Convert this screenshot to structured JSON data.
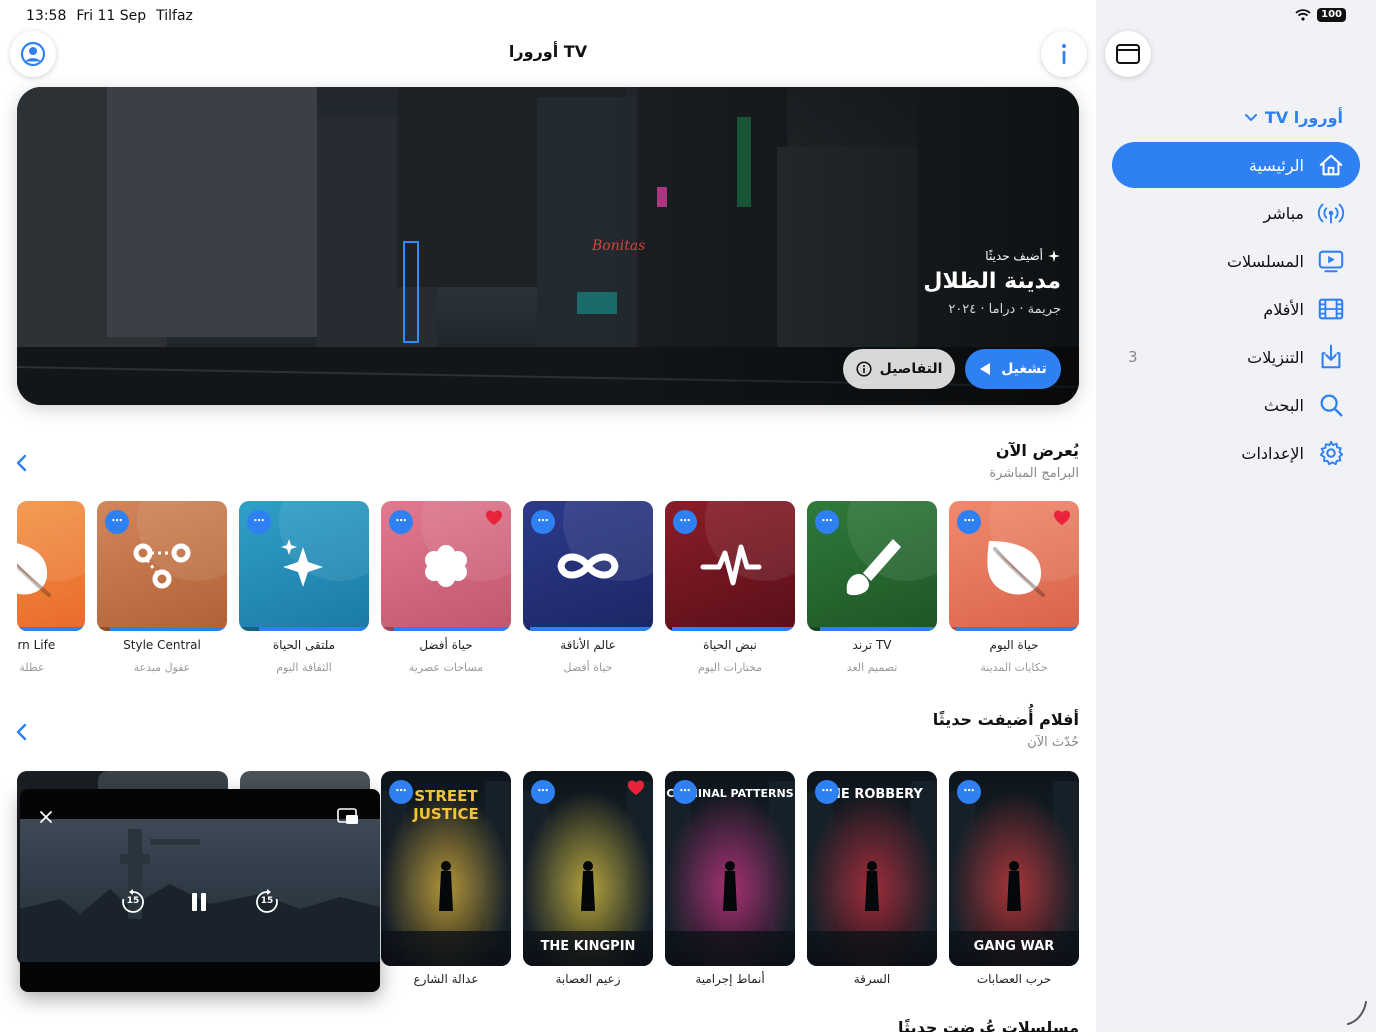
{
  "status_bar": {
    "time": "13:58",
    "date": "Fri 11 Sep",
    "carrier": "Tilfaz",
    "battery": "100"
  },
  "app": {
    "title": "أورورا TV"
  },
  "hero": {
    "badge": "أضيف حديثًا",
    "title": "مدينة الظلال",
    "meta": "جريمة · دراما · ٢٠٢٤",
    "play_label": "تشغيل",
    "details_label": "التفاصيل"
  },
  "now_showing": {
    "title": "يُعرض الآن",
    "subtitle": "البرامج المباشرة",
    "items": [
      {
        "name": "حياة اليوم",
        "sub": "حكايات المدينة",
        "c1": "#f08a6e",
        "c2": "#d9634a",
        "icon": "leaf-icon",
        "heart": true,
        "progress": 0.95
      },
      {
        "name": "ترند TV",
        "sub": "تصميم الغد",
        "c1": "#2f7a3a",
        "c2": "#1e5526",
        "icon": "brush-icon",
        "heart": false,
        "progress": 0.9
      },
      {
        "name": "نبض الحياة",
        "sub": "مختارات اليوم",
        "c1": "#8a1e2a",
        "c2": "#5a0f18",
        "icon": "pulse-icon",
        "heart": false,
        "progress": 0.95
      },
      {
        "name": "عالم الأناقة",
        "sub": "حياة أفضل",
        "c1": "#2d3a8a",
        "c2": "#1c2666",
        "icon": "infinity-icon",
        "heart": false,
        "progress": 0.95
      },
      {
        "name": "حياة أفضل",
        "sub": "مساحات عصرية",
        "c1": "#e07a90",
        "c2": "#c2566c",
        "icon": "flower-icon",
        "heart": true,
        "progress": 0.9
      },
      {
        "name": "ملتقى الحياة",
        "sub": "الثقافة اليوم",
        "c1": "#2fa0c8",
        "c2": "#1a7aa6",
        "icon": "sparkle-icon",
        "heart": false,
        "progress": 0.85
      },
      {
        "name": "Style Central",
        "sub": "عقول مبدعة",
        "c1": "#d2865a",
        "c2": "#b06236",
        "icon": "nodes-icon",
        "heart": false,
        "progress": 0.9
      },
      {
        "name": "Modern Life",
        "sub": "عطلة نهاية",
        "c1": "#f29a4a",
        "c2": "#ea6a2c",
        "icon": "leaf-icon",
        "heart": false,
        "progress": 0.8
      }
    ]
  },
  "recent_movies": {
    "title": "أفلام أُضيفت حديثًا",
    "subtitle": "حُدّث الآن",
    "items": [
      {
        "name": "حرب العصابات",
        "poster_text": "GANG WAR",
        "heart": false,
        "accent": "#e23a3a"
      },
      {
        "name": "السرقة",
        "poster_text": "THE ROBBERY",
        "heart": false,
        "accent": "#d62d3a"
      },
      {
        "name": "أنماط إجرامية",
        "poster_text": "CRIMINAL PATTERNS",
        "heart": false,
        "accent": "#e0348a"
      },
      {
        "name": "زعيم العصابة",
        "poster_text": "THE KINGPIN",
        "heart": true,
        "accent": "#f2d640"
      },
      {
        "name": "عدالة الشارع",
        "poster_text": "STREET JUSTICE",
        "heart": false,
        "accent": "#f2c23a"
      }
    ]
  },
  "next_section_title": "مسلسلات عُرضت حديثًا",
  "pip": {
    "skip_back": "15",
    "skip_forward": "15"
  },
  "sidebar": {
    "header": "أورورا TV",
    "items": [
      {
        "label": "الرئيسية",
        "icon": "home-icon",
        "active": true,
        "badge": ""
      },
      {
        "label": "مباشر",
        "icon": "broadcast-icon",
        "active": false,
        "badge": ""
      },
      {
        "label": "المسلسلات",
        "icon": "tv-play-icon",
        "active": false,
        "badge": ""
      },
      {
        "label": "الأفلام",
        "icon": "film-icon",
        "active": false,
        "badge": ""
      },
      {
        "label": "التنزيلات",
        "icon": "download-icon",
        "active": false,
        "badge": "3"
      },
      {
        "label": "البحث",
        "icon": "search-icon",
        "active": false,
        "badge": ""
      },
      {
        "label": "الإعدادات",
        "icon": "gear-icon",
        "active": false,
        "badge": ""
      }
    ]
  }
}
